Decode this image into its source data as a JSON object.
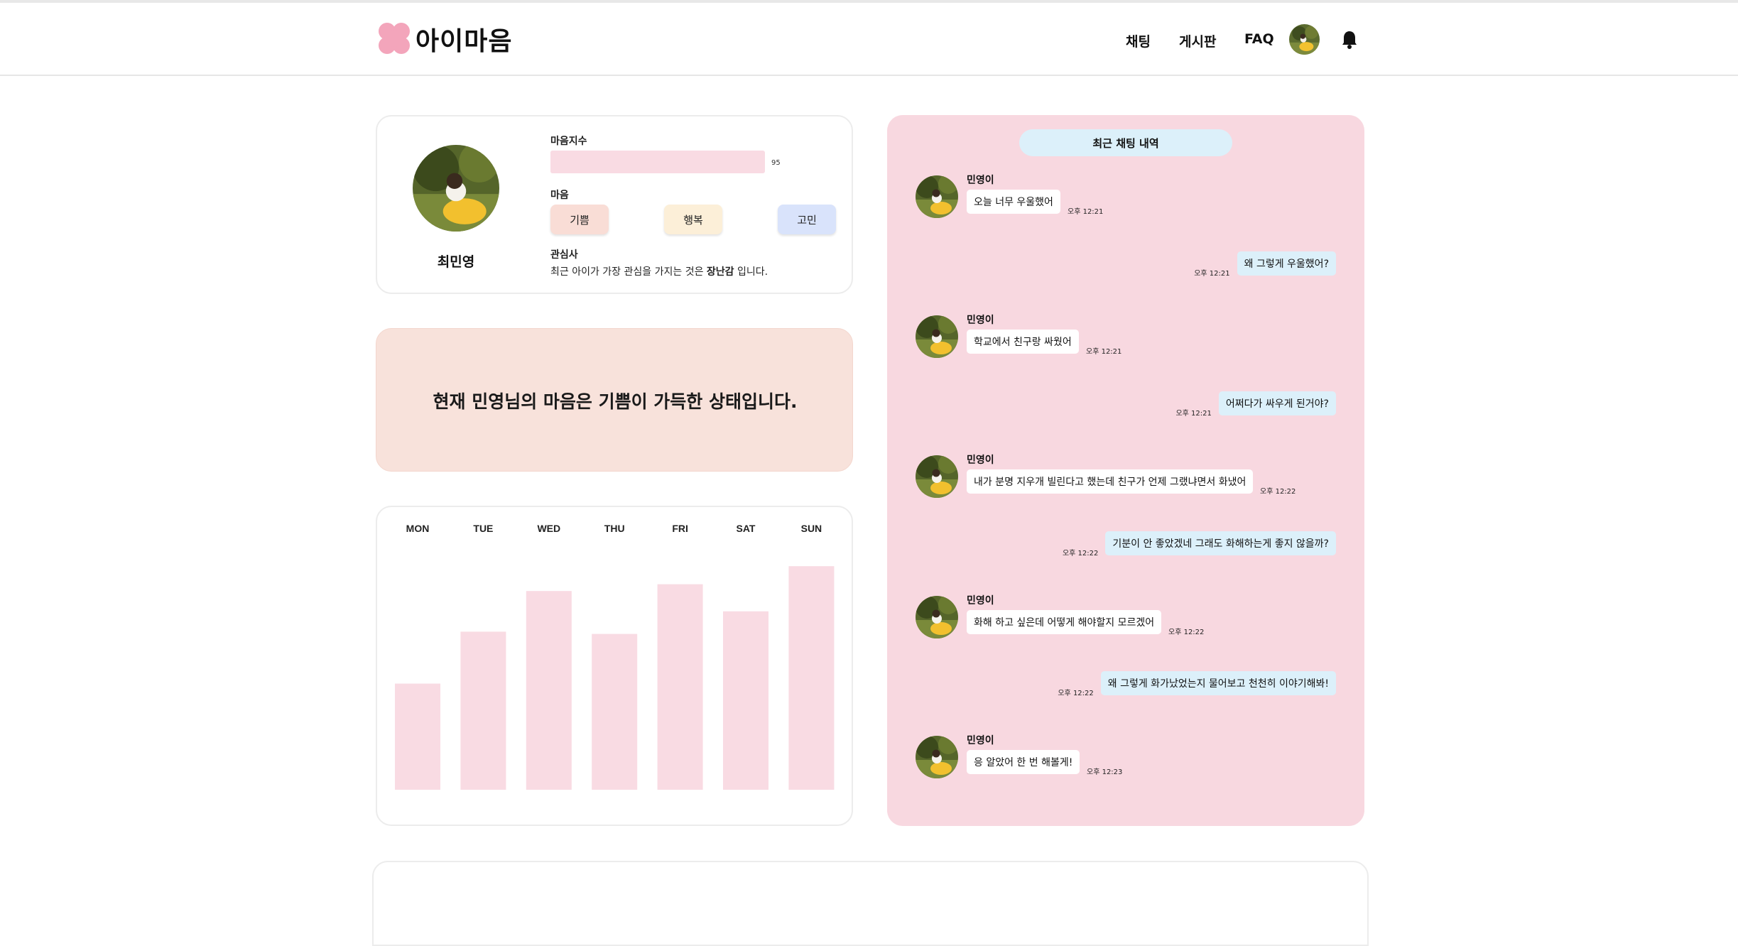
{
  "app": {
    "logo_text": "아이마음"
  },
  "nav": {
    "chat": "채팅",
    "board": "게시판",
    "faq": "FAQ"
  },
  "profile": {
    "name": "최민영",
    "index_label": "마음지수",
    "index_value": 95,
    "index_value_text": "95",
    "mood_label": "마음",
    "moods": [
      {
        "label": "기쁨",
        "color": "#f9ddd6"
      },
      {
        "label": "행복",
        "color": "#fcefd8"
      },
      {
        "label": "고민",
        "color": "#d9e3fb"
      }
    ],
    "interest_label": "관심사",
    "interest_prefix": "최근 아이가 가장 관심을 가지는 것은 ",
    "interest_value": "장난감",
    "interest_suffix": " 입니다."
  },
  "status": {
    "text": "현재 민영님의 마음은 기쁨이 가득한 상태입니다."
  },
  "chart_data": {
    "type": "bar",
    "categories": [
      "MON",
      "TUE",
      "WED",
      "THU",
      "FRI",
      "SAT",
      "SUN"
    ],
    "values": [
      47,
      70,
      88,
      69,
      91,
      79,
      99
    ],
    "ylim": [
      0,
      100
    ],
    "bar_color": "#f9dbe3",
    "legend": "none",
    "grid": false
  },
  "chat": {
    "title": "최근 채팅 내역",
    "messages": [
      {
        "side": "in",
        "name": "민영이",
        "text": "오늘 너무 우울했어",
        "time": "오후 12:21"
      },
      {
        "side": "out",
        "text": "왜 그렇게 우울했어?",
        "time": "오후 12:21"
      },
      {
        "side": "in",
        "name": "민영이",
        "text": "학교에서 친구랑 싸웠어",
        "time": "오후 12:21"
      },
      {
        "side": "out",
        "text": "어쩌다가 싸우게 된거야?",
        "time": "오후 12:21"
      },
      {
        "side": "in",
        "name": "민영이",
        "text": "내가 분명 지우개 빌린다고 했는데 친구가 언제 그랬냐면서 화냈어",
        "time": "오후 12:22"
      },
      {
        "side": "out",
        "text": "기분이 안 좋았겠네 그래도 화해하는게 좋지 않을까?",
        "time": "오후 12:22"
      },
      {
        "side": "in",
        "name": "민영이",
        "text": "화해 하고 싶은데 어떻게 해야할지 모르겠어",
        "time": "오후 12:22"
      },
      {
        "side": "out",
        "text": "왜 그렇게 화가났었는지 물어보고 천천히 이야기해봐!",
        "time": "오후 12:22"
      },
      {
        "side": "in",
        "name": "민영이",
        "text": "응 알았어 한 번 해볼게!",
        "time": "오후 12:23"
      }
    ]
  }
}
